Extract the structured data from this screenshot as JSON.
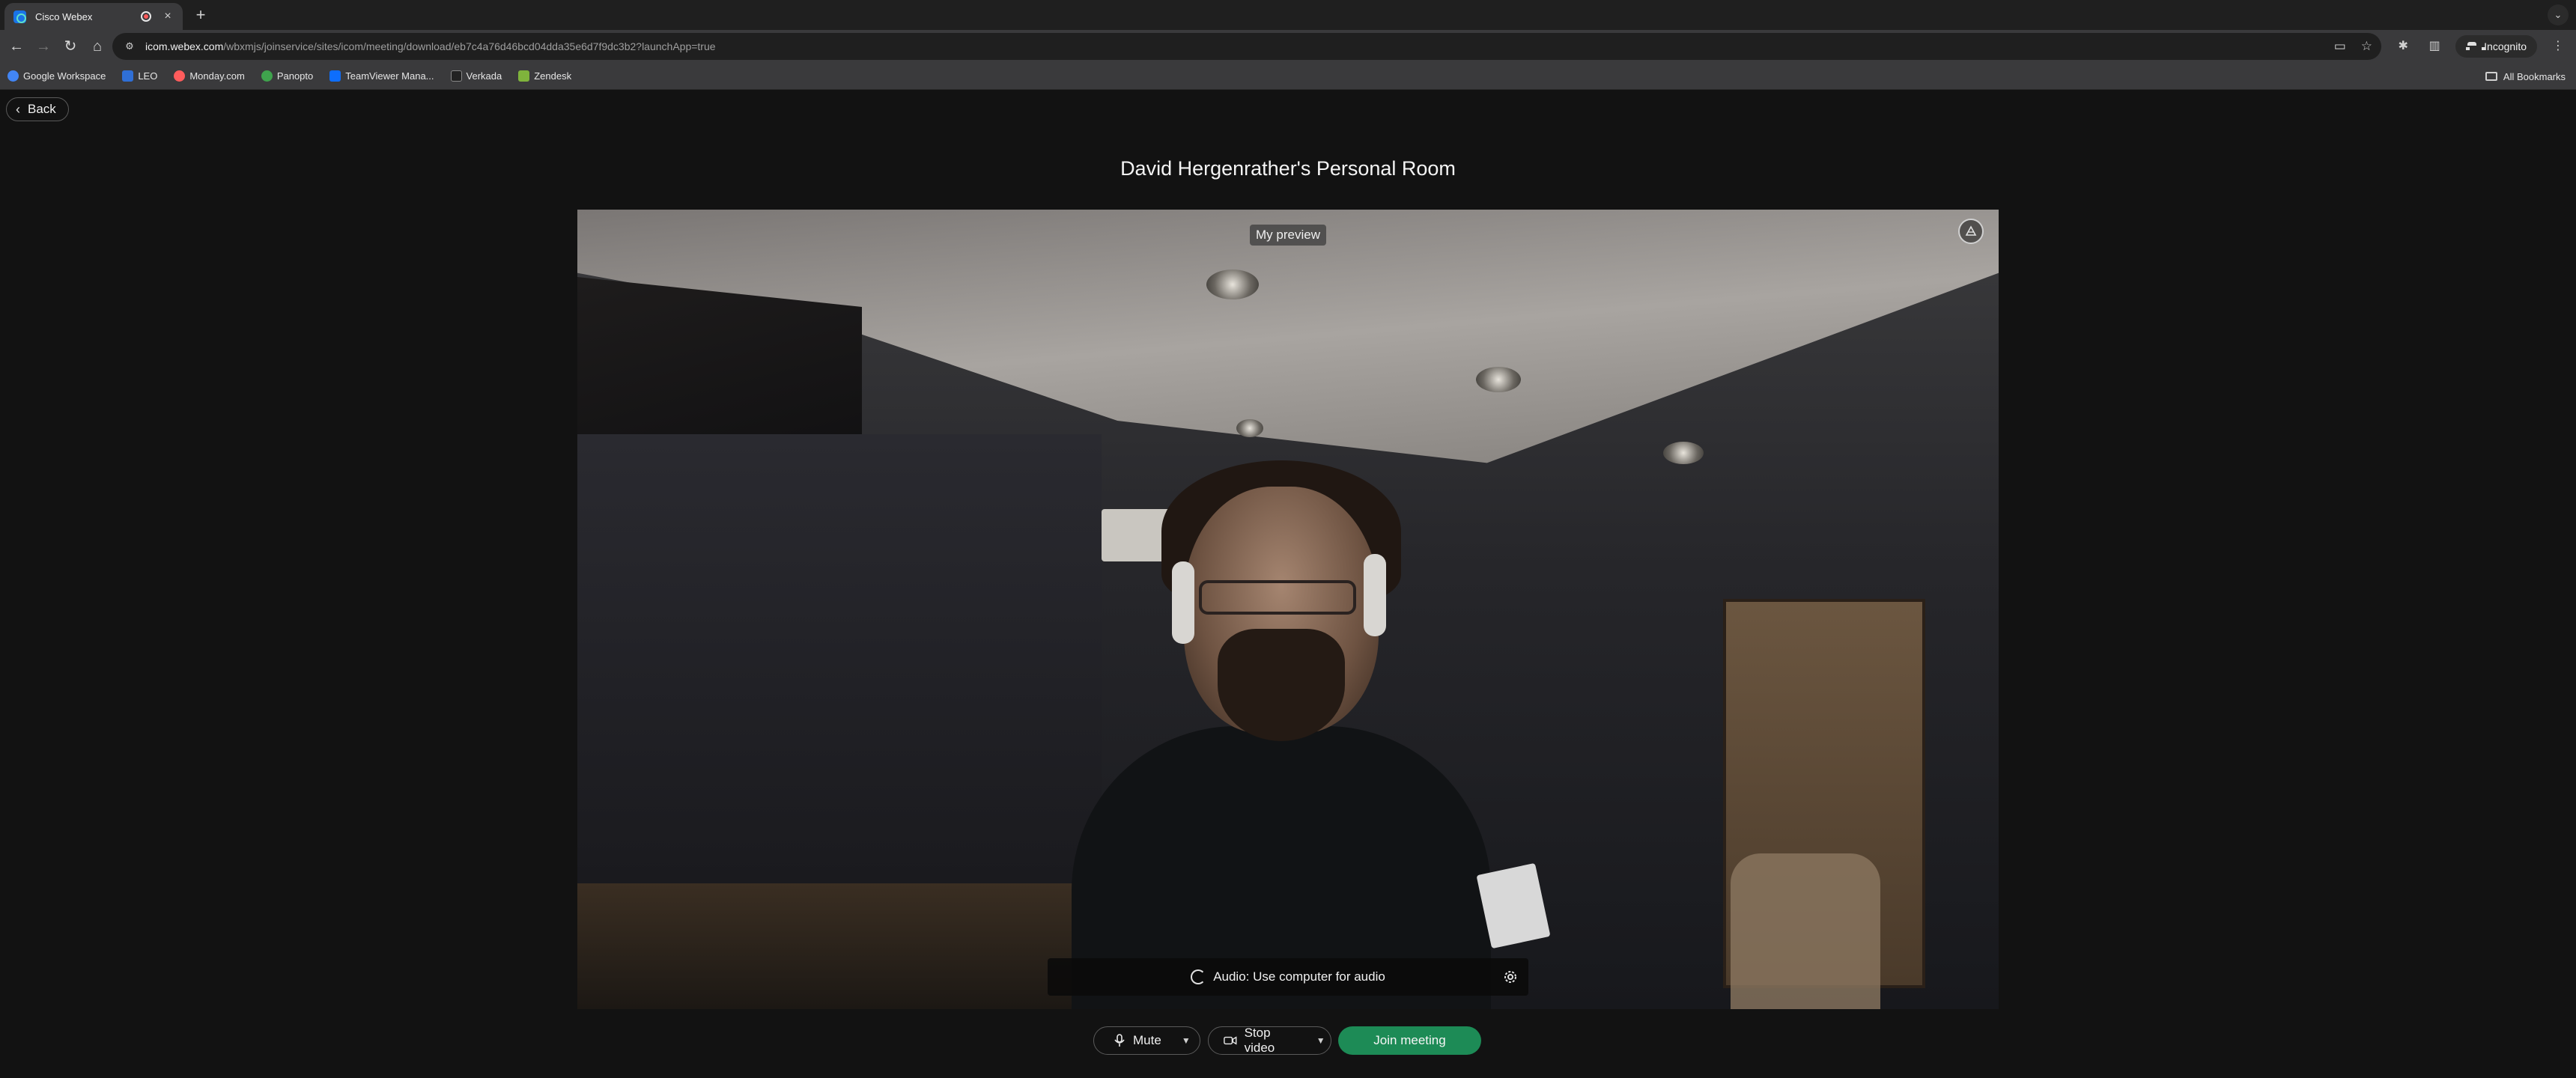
{
  "browser": {
    "tab": {
      "title": "Cisco Webex",
      "close_glyph": "×"
    },
    "new_tab_glyph": "+",
    "address": {
      "domain": "icom.webex.com",
      "path": "/wbxmjs/joinservice/sites/icom/meeting/download/eb7c4a76d46bcd04dda35e6d7f9dc3b2?launchApp=true"
    },
    "profile_label": "Incognito",
    "bookmarks": [
      {
        "label": "Google Workspace",
        "color": "#4285f4"
      },
      {
        "label": "LEO",
        "color": "#2f6fd6"
      },
      {
        "label": "Monday.com",
        "color": "#ff5c5c"
      },
      {
        "label": "Panopto",
        "color": "#3fa34d"
      },
      {
        "label": "TeamViewer Mana...",
        "color": "#0e6efd"
      },
      {
        "label": "Verkada",
        "color": "#222222"
      },
      {
        "label": "Zendesk",
        "color": "#7fb33c"
      }
    ],
    "all_bookmarks_label": "All Bookmarks"
  },
  "page": {
    "back_label": "Back",
    "room_title": "David Hergenrather's Personal Room",
    "preview_label": "My preview",
    "audio_label": "Audio: Use computer for audio",
    "controls": {
      "mute_label": "Mute",
      "stop_video_label": "Stop video",
      "join_label": "Join meeting"
    },
    "accent_color": "#1d8b56"
  }
}
